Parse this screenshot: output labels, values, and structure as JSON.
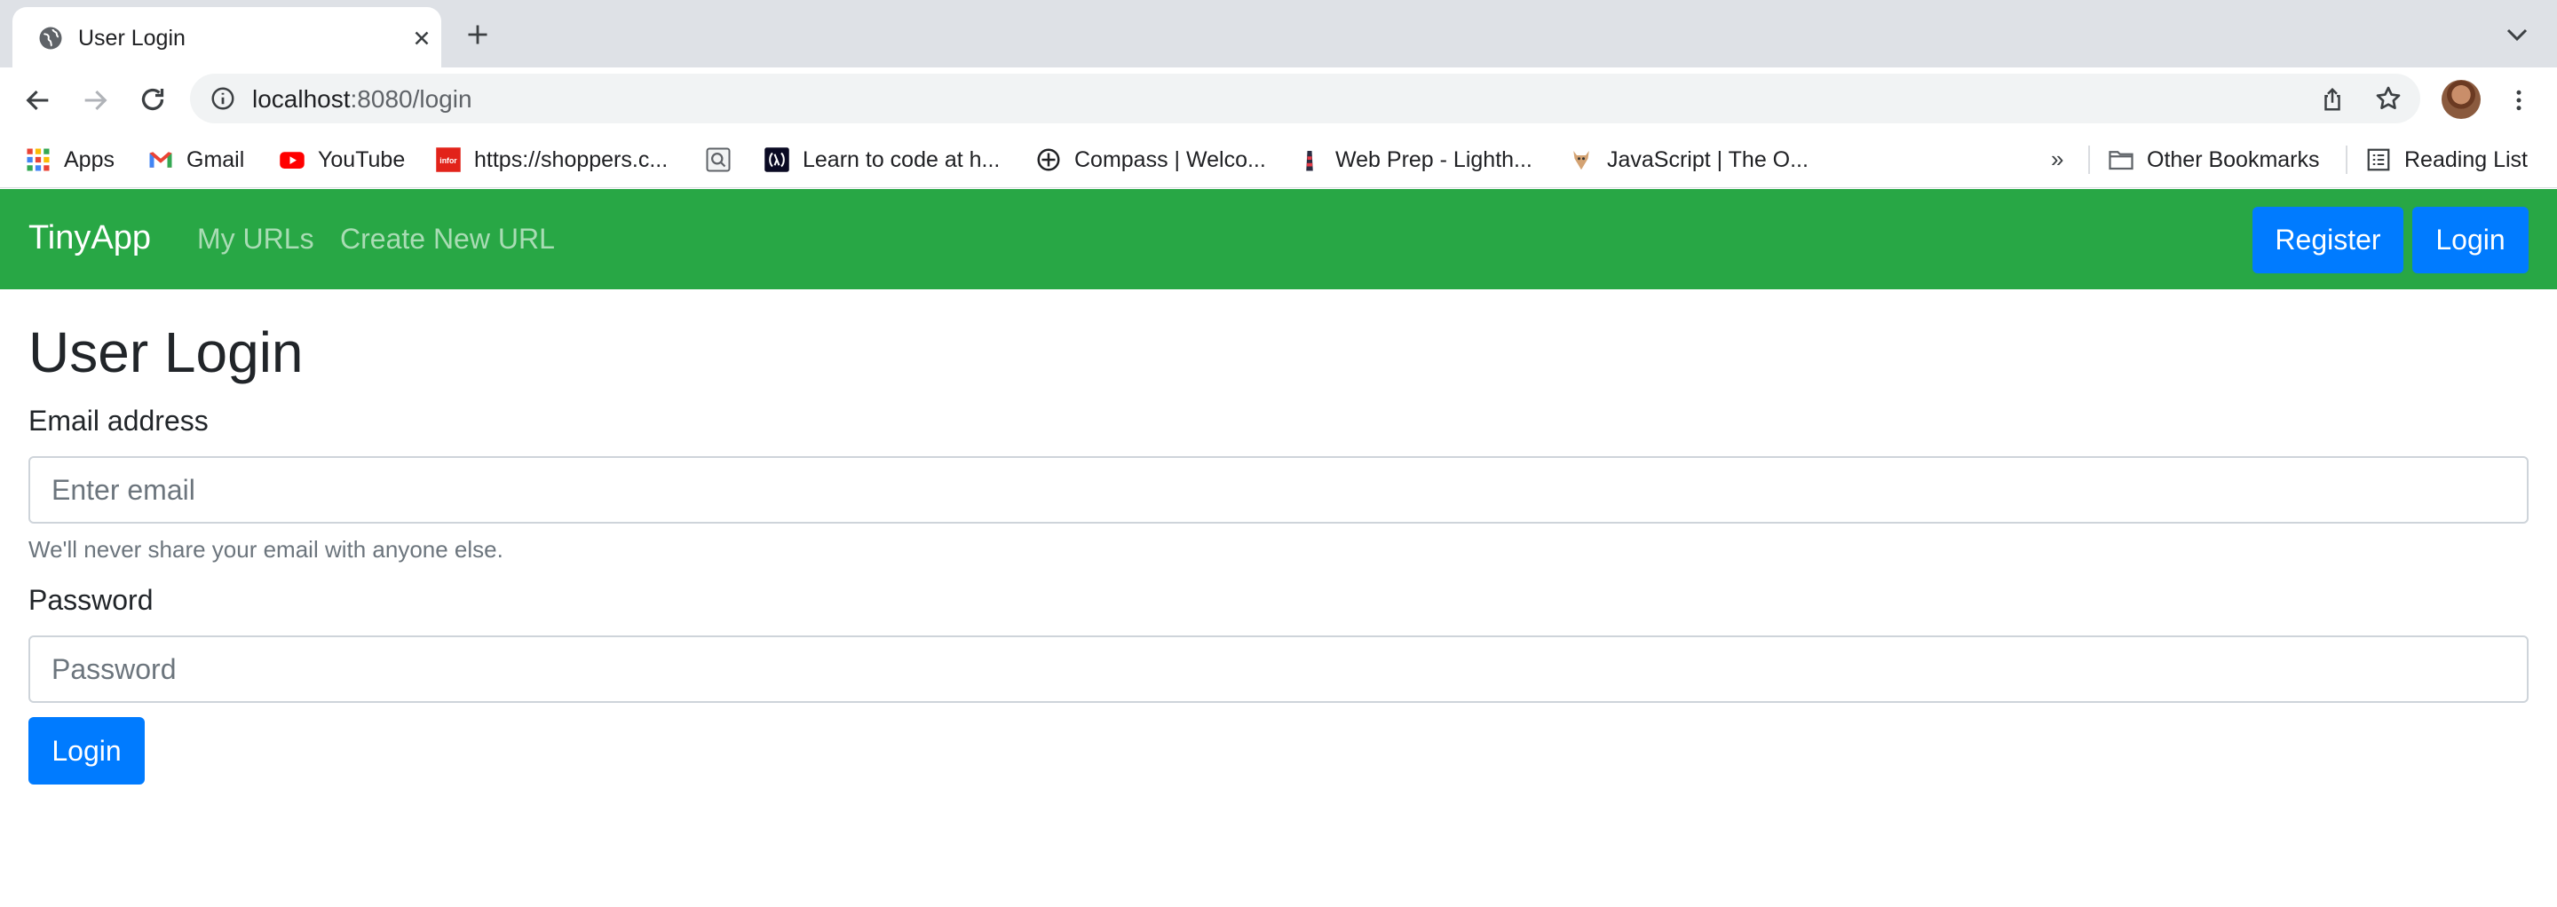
{
  "browser": {
    "tab": {
      "title": "User Login"
    },
    "address_bar": {
      "host": "localhost",
      "rest": ":8080/login"
    },
    "bookmarks": [
      {
        "label": "Apps",
        "icon": "apps-grid-icon"
      },
      {
        "label": "Gmail",
        "icon": "gmail-icon"
      },
      {
        "label": "YouTube",
        "icon": "youtube-icon"
      },
      {
        "label": "https://shoppers.c...",
        "icon": "infor-icon"
      },
      {
        "label": "",
        "icon": "search-box-icon"
      },
      {
        "label": "Learn to code at h...",
        "icon": "code-lambda-icon"
      },
      {
        "label": "Compass | Welco...",
        "icon": "compass-icon"
      },
      {
        "label": "Web Prep - Lighth...",
        "icon": "lighthouse-icon"
      },
      {
        "label": "JavaScript | The O...",
        "icon": "odin-icon"
      }
    ],
    "overflow_chevron": "»",
    "other_bookmarks": "Other Bookmarks",
    "reading_list": "Reading List"
  },
  "navbar": {
    "brand": "TinyApp",
    "links": [
      "My URLs",
      "Create New URL"
    ],
    "register_label": "Register",
    "login_label": "Login",
    "color": "#28a745"
  },
  "form": {
    "title": "User Login",
    "email_label": "Email address",
    "email_placeholder": "Enter email",
    "email_help": "We'll never share your email with anyone else.",
    "password_label": "Password",
    "password_placeholder": "Password",
    "submit_label": "Login"
  },
  "colors": {
    "primary": "#007bff",
    "success": "#28a745"
  }
}
